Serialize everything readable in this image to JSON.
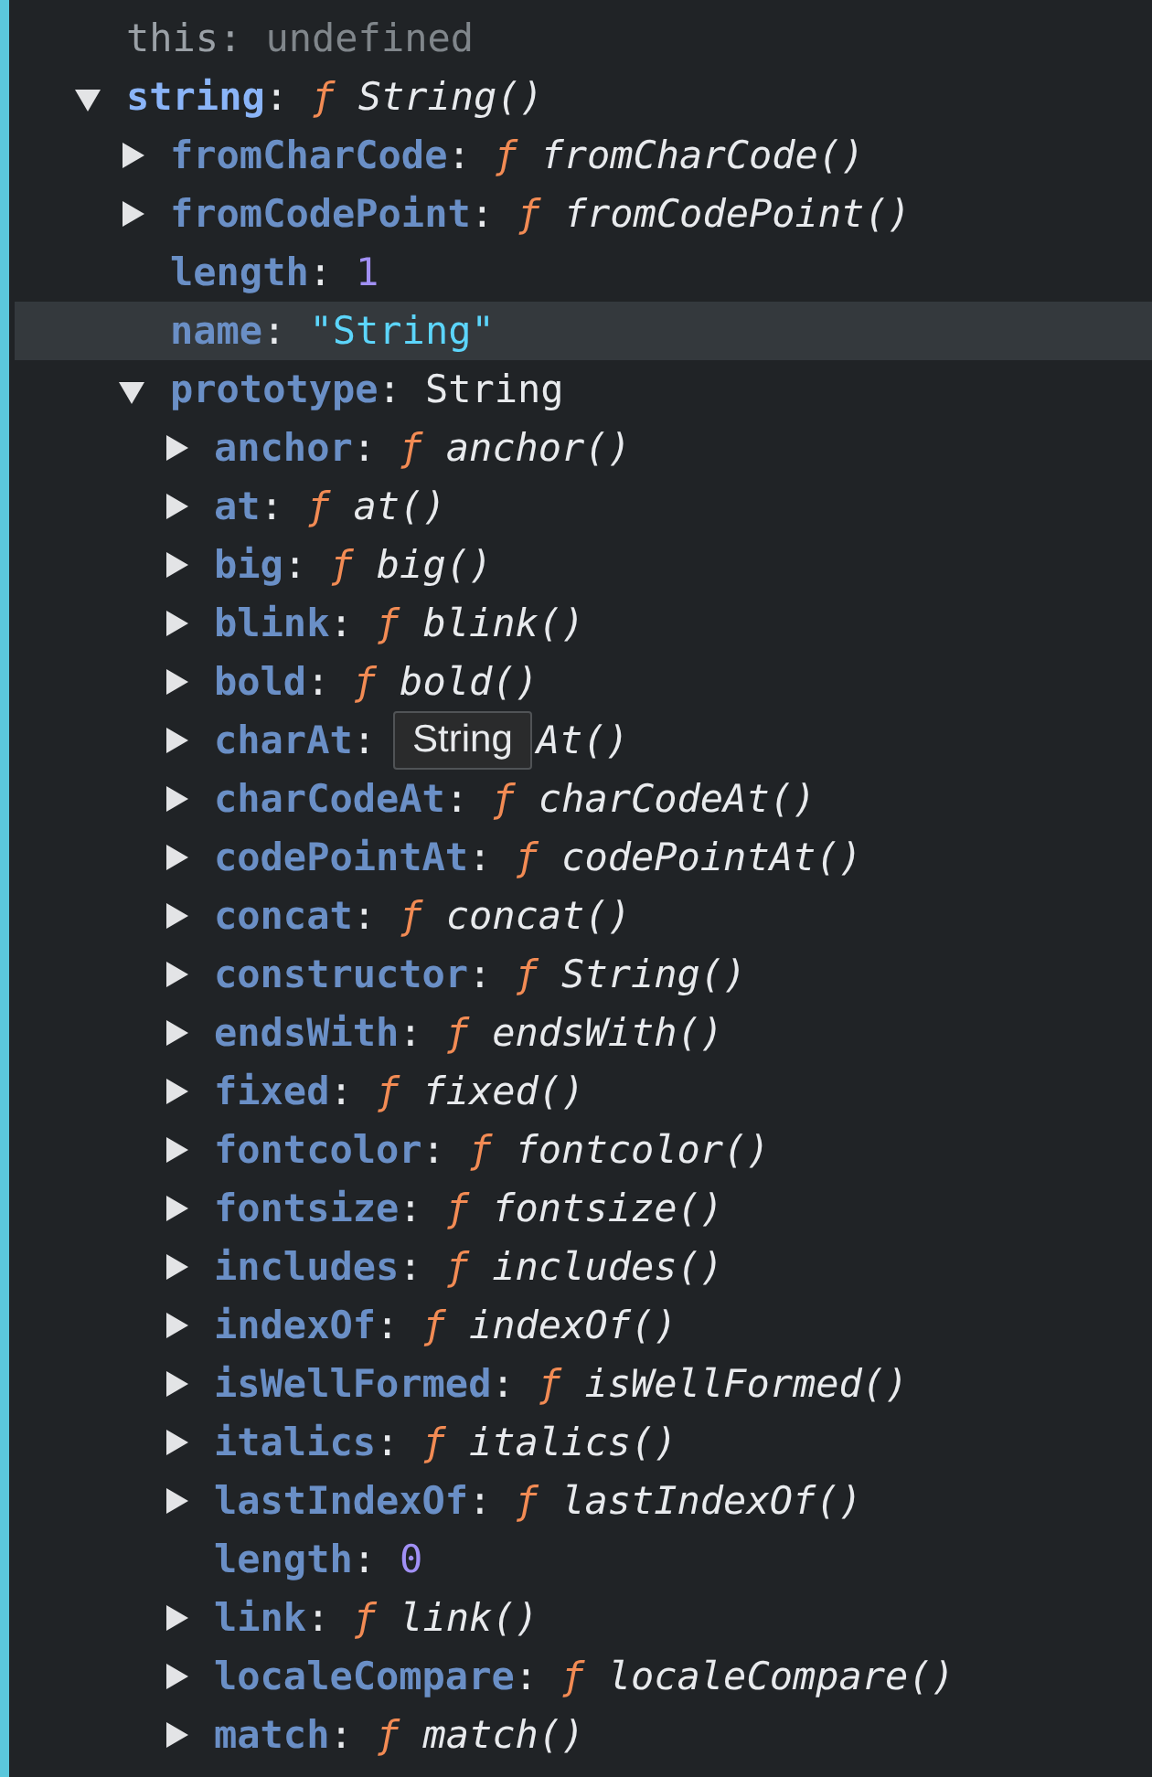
{
  "separator": ":",
  "rows": [
    {
      "key": "this",
      "kind": "undefined",
      "value": "undefined",
      "highlighted": false
    },
    {
      "key": "string",
      "kind": "function",
      "sign": "ƒ",
      "value": "String()",
      "expanded": true,
      "highlighted": false,
      "children": [
        {
          "key": "fromCharCode",
          "kind": "function",
          "sign": "ƒ",
          "value": "fromCharCode()",
          "expanded": false,
          "highlighted": false
        },
        {
          "key": "fromCodePoint",
          "kind": "function",
          "sign": "ƒ",
          "value": "fromCodePoint()",
          "expanded": false,
          "highlighted": false
        },
        {
          "key": "length",
          "kind": "number",
          "value": "1",
          "highlighted": false
        },
        {
          "key": "name",
          "kind": "string",
          "value": "\"String\"",
          "highlighted": true
        },
        {
          "key": "prototype",
          "kind": "object",
          "value": "String",
          "expanded": true,
          "highlighted": false,
          "children": [
            {
              "key": "anchor",
              "kind": "function",
              "sign": "ƒ",
              "value": "anchor()",
              "expanded": false,
              "highlighted": false
            },
            {
              "key": "at",
              "kind": "function",
              "sign": "ƒ",
              "value": "at()",
              "expanded": false,
              "highlighted": false
            },
            {
              "key": "big",
              "kind": "function",
              "sign": "ƒ",
              "value": "big()",
              "expanded": false,
              "highlighted": false
            },
            {
              "key": "blink",
              "kind": "function",
              "sign": "ƒ",
              "value": "blink()",
              "expanded": false,
              "highlighted": false
            },
            {
              "key": "bold",
              "kind": "function",
              "sign": "ƒ",
              "value": "bold()",
              "expanded": false,
              "highlighted": false
            },
            {
              "key": "charAt",
              "kind": "function",
              "tooltip": "String",
              "value": "At()",
              "expanded": false,
              "highlighted": false
            },
            {
              "key": "charCodeAt",
              "kind": "function",
              "sign": "ƒ",
              "value": "charCodeAt()",
              "expanded": false,
              "highlighted": false
            },
            {
              "key": "codePointAt",
              "kind": "function",
              "sign": "ƒ",
              "value": "codePointAt()",
              "expanded": false,
              "highlighted": false
            },
            {
              "key": "concat",
              "kind": "function",
              "sign": "ƒ",
              "value": "concat()",
              "expanded": false,
              "highlighted": false
            },
            {
              "key": "constructor",
              "kind": "function",
              "sign": "ƒ",
              "value": "String()",
              "expanded": false,
              "highlighted": false
            },
            {
              "key": "endsWith",
              "kind": "function",
              "sign": "ƒ",
              "value": "endsWith()",
              "expanded": false,
              "highlighted": false
            },
            {
              "key": "fixed",
              "kind": "function",
              "sign": "ƒ",
              "value": "fixed()",
              "expanded": false,
              "highlighted": false
            },
            {
              "key": "fontcolor",
              "kind": "function",
              "sign": "ƒ",
              "value": "fontcolor()",
              "expanded": false,
              "highlighted": false
            },
            {
              "key": "fontsize",
              "kind": "function",
              "sign": "ƒ",
              "value": "fontsize()",
              "expanded": false,
              "highlighted": false
            },
            {
              "key": "includes",
              "kind": "function",
              "sign": "ƒ",
              "value": "includes()",
              "expanded": false,
              "highlighted": false
            },
            {
              "key": "indexOf",
              "kind": "function",
              "sign": "ƒ",
              "value": "indexOf()",
              "expanded": false,
              "highlighted": false
            },
            {
              "key": "isWellFormed",
              "kind": "function",
              "sign": "ƒ",
              "value": "isWellFormed()",
              "expanded": false,
              "highlighted": false
            },
            {
              "key": "italics",
              "kind": "function",
              "sign": "ƒ",
              "value": "italics()",
              "expanded": false,
              "highlighted": false
            },
            {
              "key": "lastIndexOf",
              "kind": "function",
              "sign": "ƒ",
              "value": "lastIndexOf()",
              "expanded": false,
              "highlighted": false
            },
            {
              "key": "length",
              "kind": "number",
              "value": "0",
              "highlighted": false
            },
            {
              "key": "link",
              "kind": "function",
              "sign": "ƒ",
              "value": "link()",
              "expanded": false,
              "highlighted": false
            },
            {
              "key": "localeCompare",
              "kind": "function",
              "sign": "ƒ",
              "value": "localeCompare()",
              "expanded": false,
              "highlighted": false
            },
            {
              "key": "match",
              "kind": "function",
              "sign": "ƒ",
              "value": "match()",
              "expanded": false,
              "highlighted": false
            }
          ]
        }
      ]
    }
  ]
}
